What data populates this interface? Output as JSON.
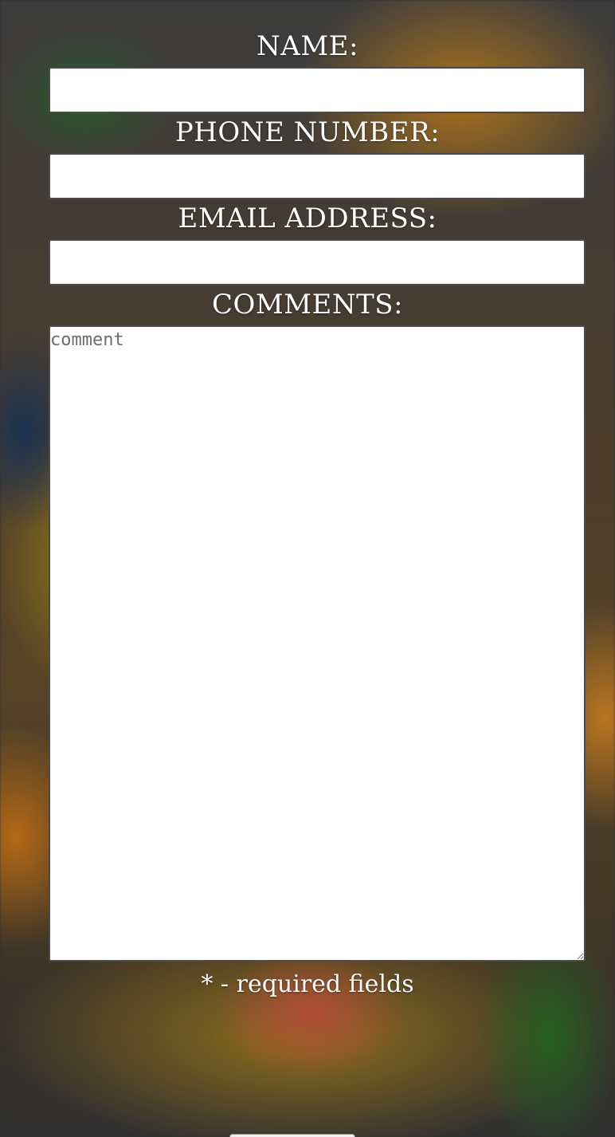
{
  "form": {
    "name_label": "NAME:",
    "name_value": "",
    "phone_label": "PHONE NUMBER:",
    "phone_value": "",
    "email_label": "EMAIL ADDRESS:",
    "email_value": "",
    "comments_label": "COMMENTS:",
    "comments_placeholder": "comment",
    "comments_value": "",
    "required_note": "* - required fields"
  },
  "background": {
    "description_icon": "citrus-photo-background"
  }
}
